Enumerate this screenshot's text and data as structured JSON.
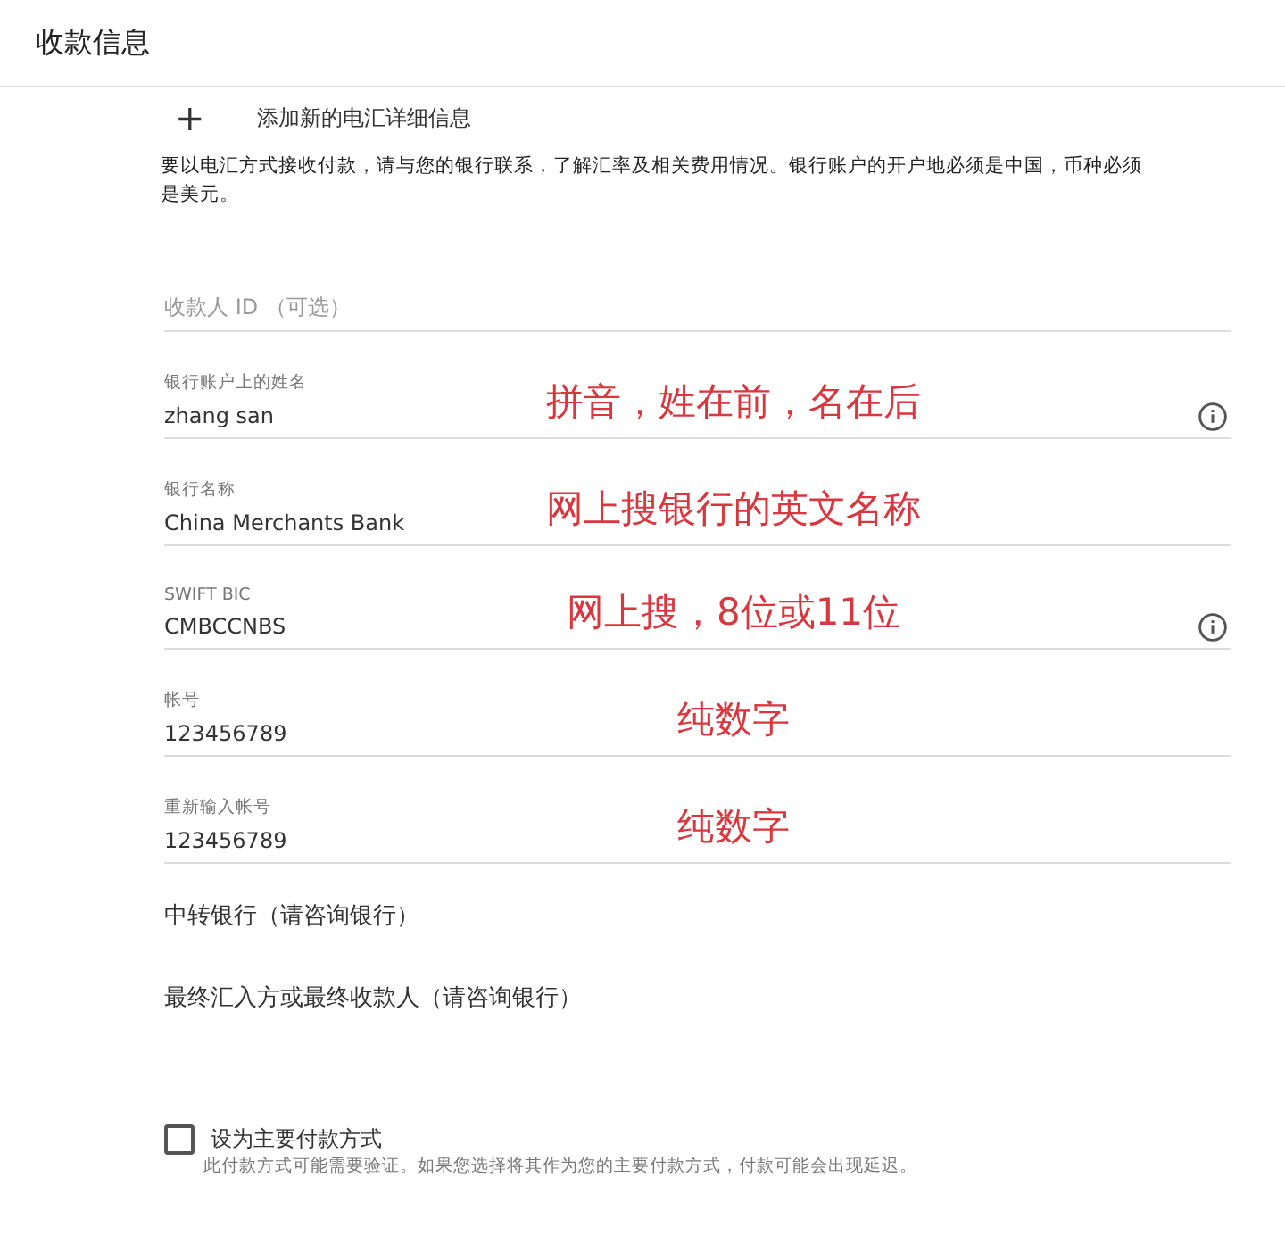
{
  "window": {
    "title": "收款信息"
  },
  "add_link": {
    "icon": "+",
    "label": "添加新的电汇详细信息"
  },
  "notice": "要以电汇方式接收付款，请与您的银行联系，了解汇率及相关费用情况。银行账户的开户地必须是中国，币种必须是美元。",
  "fields": [
    {
      "kind": "empty",
      "placeholder": "收款人 ID （可选）"
    },
    {
      "kind": "filled",
      "label": "银行账户上的姓名",
      "value": "zhang san",
      "info": true,
      "annotation": "拼音，姓在前，名在后"
    },
    {
      "kind": "filled",
      "label": "银行名称",
      "value": "China Merchants Bank",
      "info": false,
      "annotation": "网上搜银行的英文名称"
    },
    {
      "kind": "filled",
      "label": "SWIFT BIC",
      "value": "CMBCCNBS",
      "info": true,
      "annotation": "网上搜，8位或11位"
    },
    {
      "kind": "filled",
      "label": "帐号",
      "value": "123456789",
      "info": false,
      "annotation": "纯数字"
    },
    {
      "kind": "filled",
      "label": "重新输入帐号",
      "value": "123456789",
      "info": false,
      "annotation": "纯数字"
    }
  ],
  "sections": [
    "中转银行（请咨询银行）",
    "最终汇入方或最终收款人（请咨询银行）"
  ],
  "primary": {
    "label": "设为主要付款方式",
    "checked": false,
    "note": "此付款方式可能需要验证。如果您选择将其作为您的主要付款方式，付款可能会出现延迟。"
  }
}
